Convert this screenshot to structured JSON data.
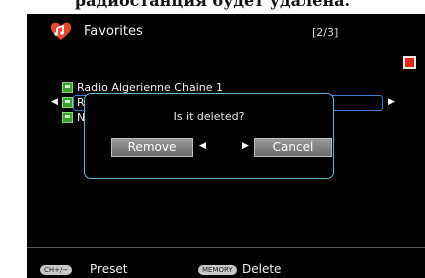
{
  "caption": "радиостанция будет удалена.",
  "header": {
    "title": "Favorites",
    "page_count": "[2/3]"
  },
  "list": {
    "items": [
      {
        "label": "Radio Algerienne Chaine 1"
      },
      {
        "label": "R"
      },
      {
        "label": "N"
      }
    ],
    "selected_index": 1
  },
  "dialog": {
    "message": "Is it deleted?",
    "remove_label": "Remove",
    "cancel_label": "Cancel"
  },
  "footer": {
    "preset_key": "CH+/−",
    "preset_label": "Preset",
    "delete_key": "MEMORY",
    "delete_label": "Delete"
  },
  "colors": {
    "accent_border": "#63b8c8",
    "selection": "#3e7ad6",
    "marker": "#e2231a",
    "folder": "#3c9f32"
  },
  "icons": {
    "header": "heart-radio-icon",
    "item": "folder-icon",
    "marker": "red-square-icon"
  }
}
